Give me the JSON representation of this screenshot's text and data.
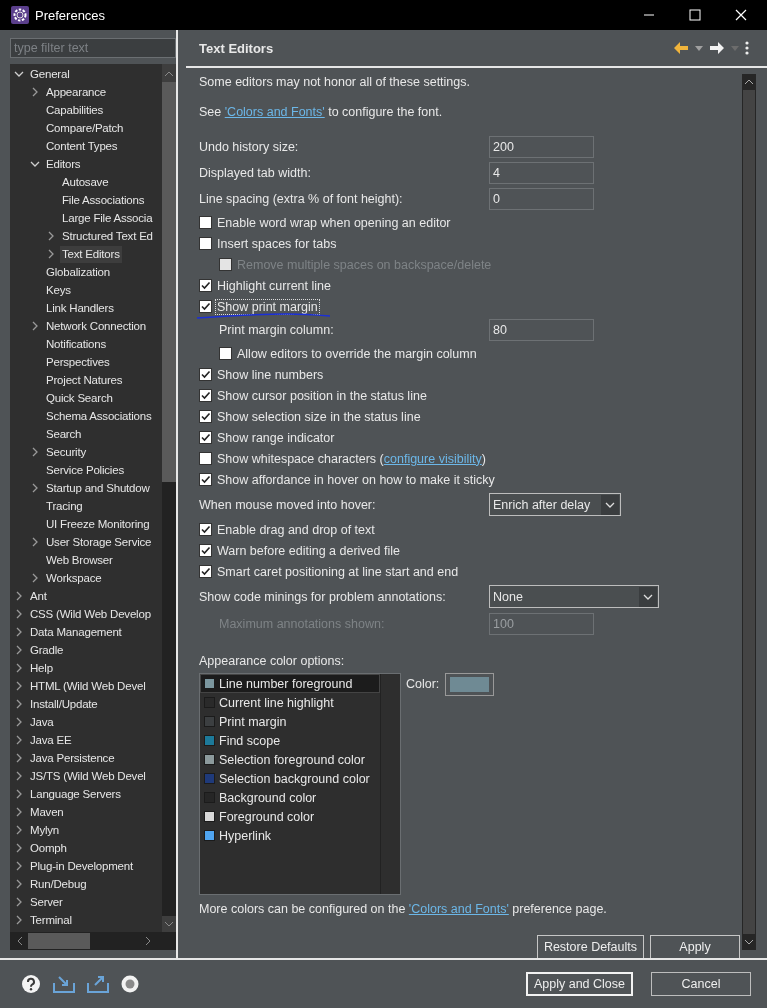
{
  "window": {
    "title": "Preferences"
  },
  "filter": {
    "placeholder": "type filter text"
  },
  "tree": [
    {
      "label": "General",
      "kind": "branch",
      "expanded": true,
      "selected": false,
      "children": [
        {
          "label": "Appearance",
          "kind": "branch",
          "expanded": false,
          "selected": false
        },
        {
          "label": "Capabilities",
          "kind": "leaf",
          "selected": false
        },
        {
          "label": "Compare/Patch",
          "kind": "leaf",
          "selected": false
        },
        {
          "label": "Content Types",
          "kind": "leaf",
          "selected": false
        },
        {
          "label": "Editors",
          "kind": "branch",
          "expanded": true,
          "selected": false,
          "children": [
            {
              "label": "Autosave",
              "kind": "leaf",
              "selected": false
            },
            {
              "label": "File Associations",
              "kind": "leaf",
              "selected": false
            },
            {
              "label": "Large File Associa",
              "kind": "leaf",
              "selected": false
            },
            {
              "label": "Structured Text Ed",
              "kind": "branch",
              "expanded": false,
              "selected": false
            },
            {
              "label": "Text Editors",
              "kind": "branch",
              "expanded": false,
              "selected": true
            }
          ]
        },
        {
          "label": "Globalization",
          "kind": "leaf",
          "selected": false
        },
        {
          "label": "Keys",
          "kind": "leaf",
          "selected": false
        },
        {
          "label": "Link Handlers",
          "kind": "leaf",
          "selected": false
        },
        {
          "label": "Network Connection",
          "kind": "branch",
          "expanded": false,
          "selected": false
        },
        {
          "label": "Notifications",
          "kind": "leaf",
          "selected": false
        },
        {
          "label": "Perspectives",
          "kind": "leaf",
          "selected": false
        },
        {
          "label": "Project Natures",
          "kind": "leaf",
          "selected": false
        },
        {
          "label": "Quick Search",
          "kind": "leaf",
          "selected": false
        },
        {
          "label": "Schema Associations",
          "kind": "leaf",
          "selected": false
        },
        {
          "label": "Search",
          "kind": "leaf",
          "selected": false
        },
        {
          "label": "Security",
          "kind": "branch",
          "expanded": false,
          "selected": false
        },
        {
          "label": "Service Policies",
          "kind": "leaf",
          "selected": false
        },
        {
          "label": "Startup and Shutdow",
          "kind": "branch",
          "expanded": false,
          "selected": false
        },
        {
          "label": "Tracing",
          "kind": "leaf",
          "selected": false
        },
        {
          "label": "UI Freeze Monitoring",
          "kind": "leaf",
          "selected": false
        },
        {
          "label": "User Storage Service",
          "kind": "branch",
          "expanded": false,
          "selected": false
        },
        {
          "label": "Web Browser",
          "kind": "leaf",
          "selected": false
        },
        {
          "label": "Workspace",
          "kind": "branch",
          "expanded": false,
          "selected": false
        }
      ]
    },
    {
      "label": "Ant",
      "kind": "branch",
      "expanded": false,
      "selected": false
    },
    {
      "label": "CSS (Wild Web Develop",
      "kind": "branch",
      "expanded": false,
      "selected": false
    },
    {
      "label": "Data Management",
      "kind": "branch",
      "expanded": false,
      "selected": false
    },
    {
      "label": "Gradle",
      "kind": "branch",
      "expanded": false,
      "selected": false
    },
    {
      "label": "Help",
      "kind": "branch",
      "expanded": false,
      "selected": false
    },
    {
      "label": "HTML (Wild Web Devel",
      "kind": "branch",
      "expanded": false,
      "selected": false
    },
    {
      "label": "Install/Update",
      "kind": "branch",
      "expanded": false,
      "selected": false
    },
    {
      "label": "Java",
      "kind": "branch",
      "expanded": false,
      "selected": false
    },
    {
      "label": "Java EE",
      "kind": "branch",
      "expanded": false,
      "selected": false
    },
    {
      "label": "Java Persistence",
      "kind": "branch",
      "expanded": false,
      "selected": false
    },
    {
      "label": "JS/TS (Wild Web Devel",
      "kind": "branch",
      "expanded": false,
      "selected": false
    },
    {
      "label": "Language Servers",
      "kind": "branch",
      "expanded": false,
      "selected": false
    },
    {
      "label": "Maven",
      "kind": "branch",
      "expanded": false,
      "selected": false
    },
    {
      "label": "Mylyn",
      "kind": "branch",
      "expanded": false,
      "selected": false
    },
    {
      "label": "Oomph",
      "kind": "branch",
      "expanded": false,
      "selected": false
    },
    {
      "label": "Plug-in Development",
      "kind": "branch",
      "expanded": false,
      "selected": false
    },
    {
      "label": "Run/Debug",
      "kind": "branch",
      "expanded": false,
      "selected": false
    },
    {
      "label": "Server",
      "kind": "branch",
      "expanded": false,
      "selected": false
    },
    {
      "label": "Terminal",
      "kind": "branch",
      "expanded": false,
      "selected": false
    }
  ],
  "page": {
    "title": "Text Editors",
    "intro": "Some editors may not honor all of these settings.",
    "font_note": {
      "before": "See ",
      "link": "'Colors and Fonts'",
      "after": " to configure the font."
    }
  },
  "settings": [
    {
      "kind": "field",
      "label": "Undo history size:",
      "value": "200",
      "disabled": false
    },
    {
      "kind": "field",
      "label": "Displayed tab width:",
      "value": "4",
      "disabled": false
    },
    {
      "kind": "field",
      "label": "Line spacing (extra % of font height):",
      "value": "0",
      "disabled": false
    },
    {
      "kind": "checkbox",
      "label": "Enable word wrap when opening an editor",
      "checked": false,
      "disabled": false,
      "focused": false
    },
    {
      "kind": "checkbox",
      "label": "Insert spaces for tabs",
      "checked": false,
      "disabled": false,
      "focused": false,
      "children": [
        {
          "kind": "checkbox",
          "label": "Remove multiple spaces on backspace/delete",
          "checked": false,
          "disabled": true,
          "focused": false
        }
      ]
    },
    {
      "kind": "checkbox",
      "label": "Highlight current line",
      "checked": true,
      "disabled": false,
      "focused": false
    },
    {
      "kind": "checkbox",
      "label": "Show print margin",
      "checked": true,
      "disabled": false,
      "focused": true,
      "pen_underline": true,
      "children": [
        {
          "kind": "field",
          "label": "Print margin column:",
          "value": "80",
          "disabled": false
        },
        {
          "kind": "checkbox",
          "label": "Allow editors to override the margin column",
          "checked": false,
          "disabled": false,
          "focused": false
        }
      ]
    },
    {
      "kind": "checkbox",
      "label": "Show line numbers",
      "checked": true,
      "disabled": false,
      "focused": false
    },
    {
      "kind": "checkbox",
      "label": "Show cursor position in the status line",
      "checked": true,
      "disabled": false,
      "focused": false
    },
    {
      "kind": "checkbox",
      "label": "Show selection size in the status line",
      "checked": true,
      "disabled": false,
      "focused": false
    },
    {
      "kind": "checkbox",
      "label": "Show range indicator",
      "checked": true,
      "disabled": false,
      "focused": false
    },
    {
      "kind": "checkbox",
      "label": "Show whitespace characters (",
      "link": "configure visibility",
      "label_after": ")",
      "checked": false,
      "disabled": false,
      "focused": false
    },
    {
      "kind": "checkbox",
      "label": "Show affordance in hover on how to make it sticky",
      "checked": true,
      "disabled": false,
      "focused": false
    },
    {
      "kind": "select",
      "label": "When mouse moved into hover:",
      "value": "Enrich after delay",
      "wide": false
    },
    {
      "kind": "checkbox",
      "label": "Enable drag and drop of text",
      "checked": true,
      "disabled": false,
      "focused": false
    },
    {
      "kind": "checkbox",
      "label": "Warn before editing a derived file",
      "checked": true,
      "disabled": false,
      "focused": false
    },
    {
      "kind": "checkbox",
      "label": "Smart caret positioning at line start and end",
      "checked": true,
      "disabled": false,
      "focused": false
    },
    {
      "kind": "select",
      "label": "Show code minings for problem annotations:",
      "value": "None",
      "wide": true,
      "children": [
        {
          "kind": "field",
          "label": "Maximum annotations shown:",
          "value": "100",
          "disabled": true
        }
      ]
    }
  ],
  "appearance_colors": {
    "label": "Appearance color options:",
    "items": [
      {
        "name": "Line number foreground",
        "color": "#7b969e",
        "selected": true
      },
      {
        "name": "Current line highlight",
        "color": "#2a2a2a",
        "selected": false
      },
      {
        "name": "Print margin",
        "color": "#3c3f41",
        "selected": false
      },
      {
        "name": "Find scope",
        "color": "#1d7a9a",
        "selected": false
      },
      {
        "name": "Selection foreground color",
        "color": "#8c9a9c",
        "selected": false
      },
      {
        "name": "Selection background color",
        "color": "#1f3a7a",
        "selected": false
      },
      {
        "name": "Background color",
        "color": "#262626",
        "selected": false
      },
      {
        "name": "Foreground color",
        "color": "#d8d8d8",
        "selected": false
      },
      {
        "name": "Hyperlink",
        "color": "#4fa4f0",
        "selected": false
      }
    ],
    "color_label": "Color:",
    "picker": {
      "color": "#6f8a94"
    }
  },
  "more_colors": {
    "before": "More colors can be configured on the ",
    "link": "'Colors and Fonts'",
    "after": " preference page."
  },
  "page_buttons": [
    "Restore Defaults",
    "Apply"
  ],
  "dialog_buttons": [
    {
      "label": "Apply and Close",
      "default": true
    },
    {
      "label": "Cancel",
      "default": false
    }
  ]
}
